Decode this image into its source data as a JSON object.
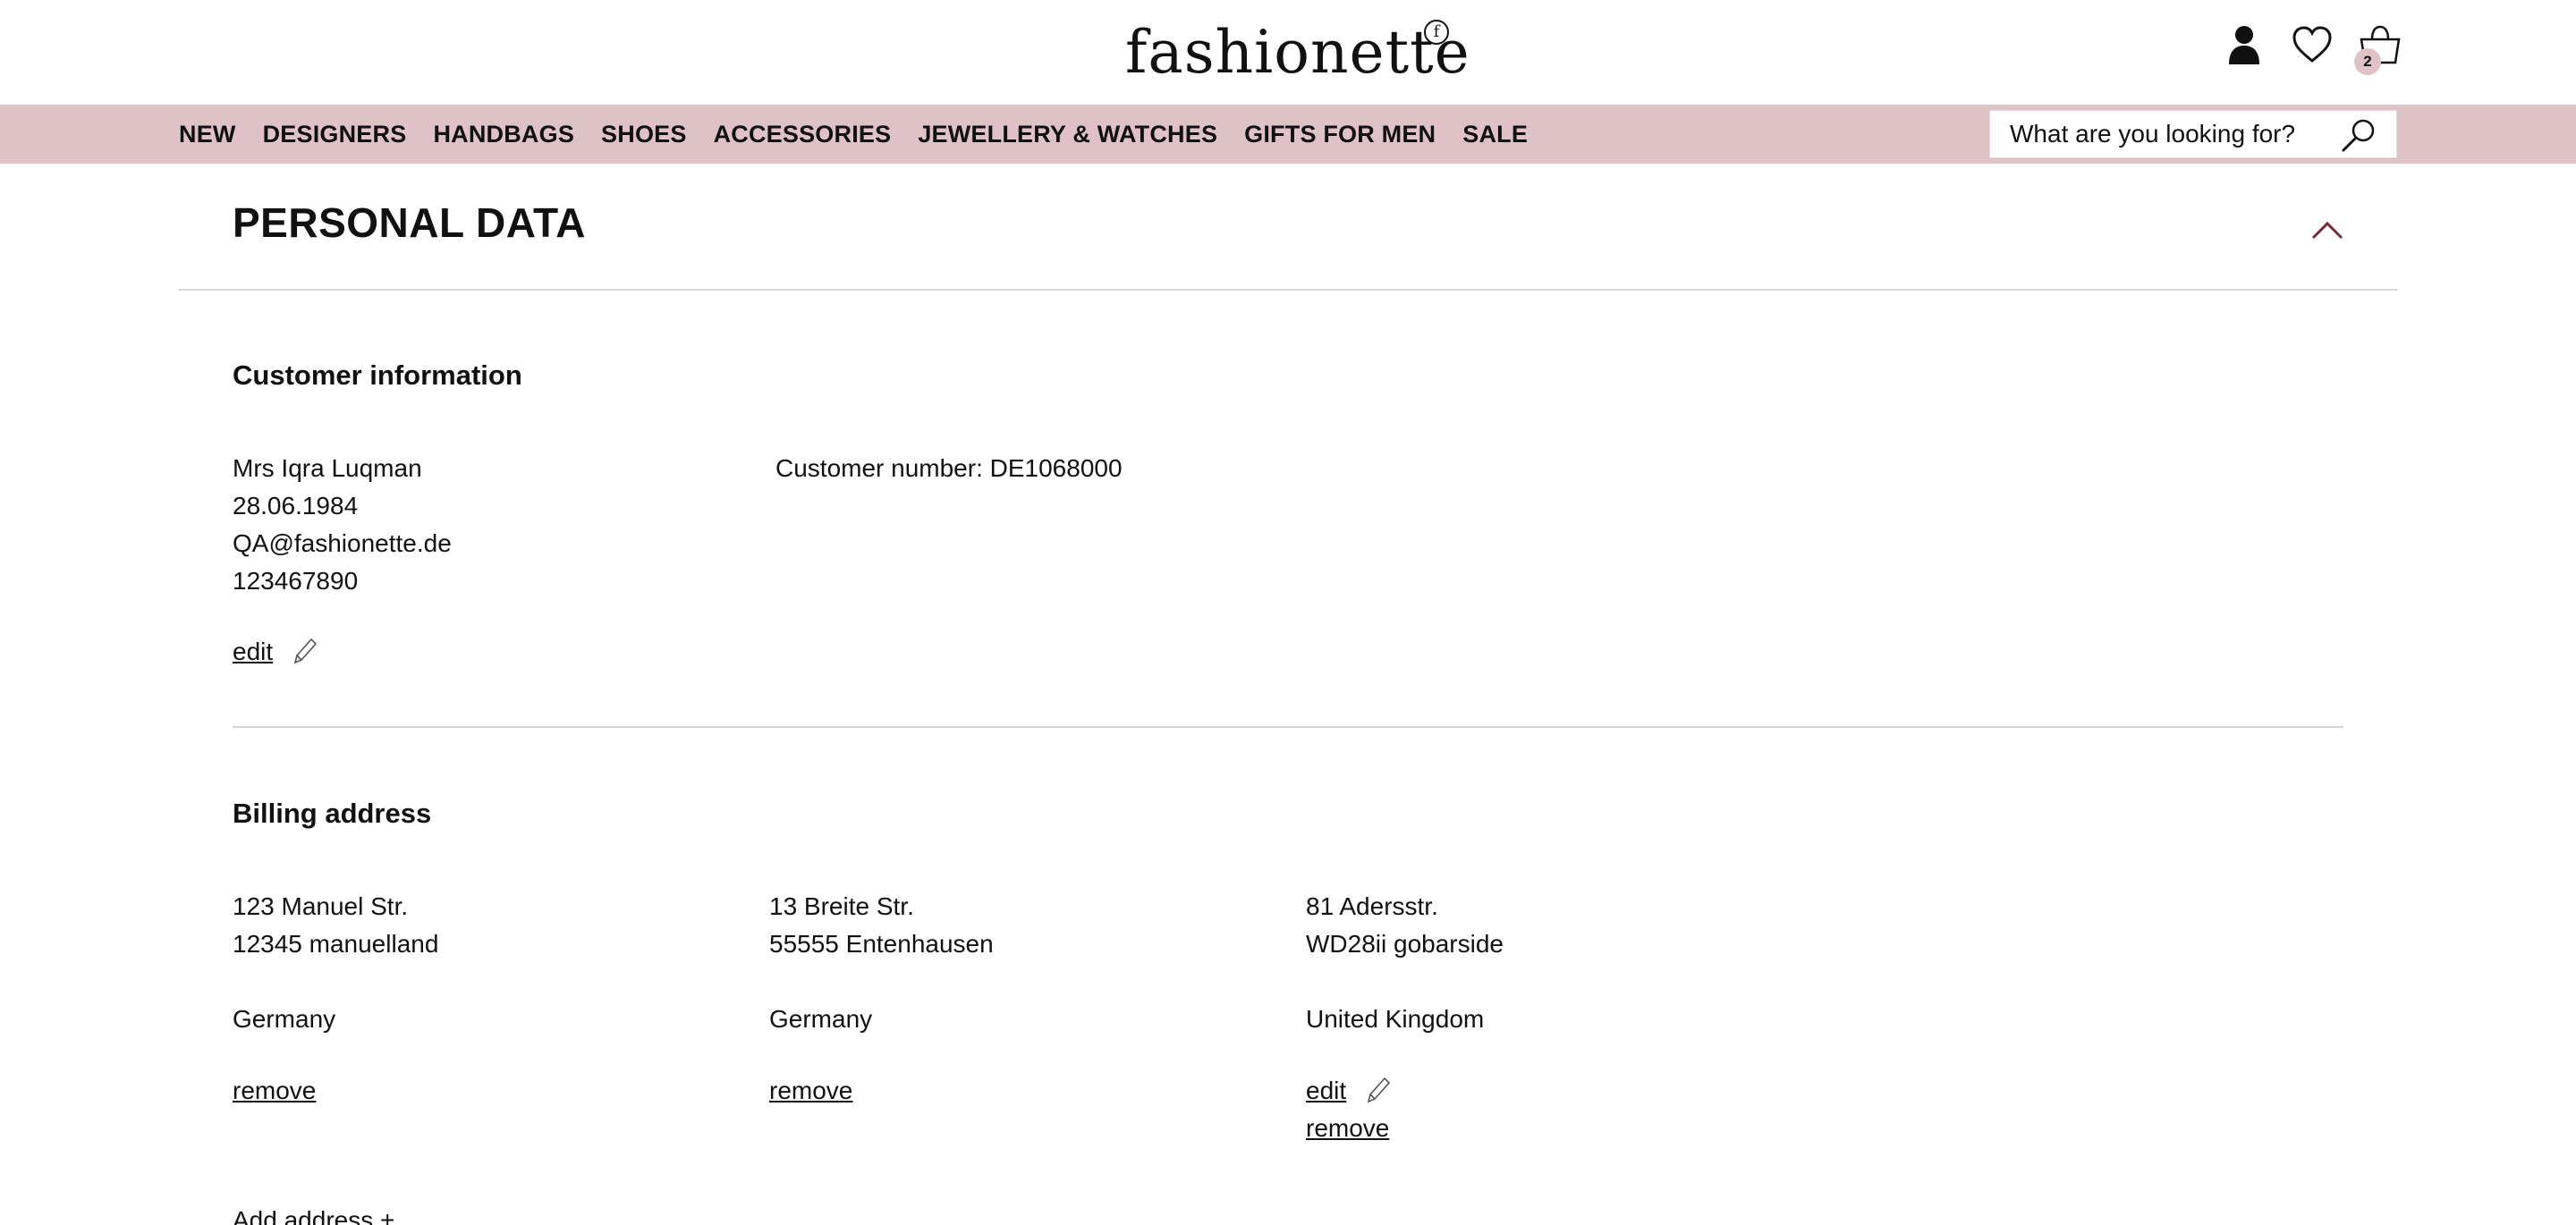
{
  "header": {
    "logo": "fashionette",
    "logo_mark": "f",
    "cart_count": "2"
  },
  "nav": {
    "items": [
      "NEW",
      "DESIGNERS",
      "HANDBAGS",
      "SHOES",
      "ACCESSORIES",
      "JEWELLERY & WATCHES",
      "GIFTS FOR MEN",
      "SALE"
    ],
    "search_placeholder": "What are you looking for?"
  },
  "section": {
    "title": "PERSONAL DATA"
  },
  "customer": {
    "heading": "Customer information",
    "name": "Mrs Iqra Luqman",
    "birthdate": "28.06.1984",
    "email": "QA@fashionette.de",
    "phone": "123467890",
    "customer_number": "Customer number: DE1068000",
    "edit_label": "edit"
  },
  "billing": {
    "heading": "Billing address",
    "addresses": [
      {
        "street": "123 Manuel Str.",
        "city": "12345 manuelland",
        "country": "Germany",
        "remove_label": "remove"
      },
      {
        "street": "13 Breite Str.",
        "city": "55555 Entenhausen",
        "country": "Germany",
        "remove_label": "remove"
      },
      {
        "street": "81 Adersstr.",
        "city": "WD28ii gobarside",
        "country": "United Kingdom",
        "edit_label": "edit",
        "remove_label": "remove"
      }
    ],
    "add_address": "Add address +"
  },
  "colors": {
    "nav_background": "#dfc2c6",
    "accent": "#7a2a3a",
    "divider": "#d4d4d4"
  },
  "icons": [
    "user-icon",
    "heart-icon",
    "shopping-bag-icon",
    "search-icon",
    "chevron-up-icon",
    "pencil-icon"
  ]
}
